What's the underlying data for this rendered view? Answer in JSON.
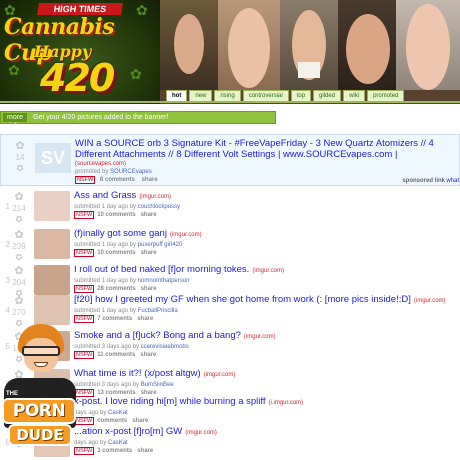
{
  "header": {
    "brand": "HIGH TIMES",
    "logo_line1": "Cannabis Cup",
    "logo_line2": "Happy",
    "logo_line3": "420",
    "tabs": [
      {
        "label": "hot",
        "active": true
      },
      {
        "label": "new",
        "active": false
      },
      {
        "label": "rising",
        "active": false
      },
      {
        "label": "controversial",
        "active": false
      },
      {
        "label": "top",
        "active": false
      },
      {
        "label": "gilded",
        "active": false
      },
      {
        "label": "wiki",
        "active": false
      },
      {
        "label": "promoted",
        "active": false
      }
    ]
  },
  "banner": {
    "text": "Get your 4/20 pictures added to the banner!",
    "link": "more info"
  },
  "sponsored": {
    "score": "14",
    "title": "WIN a SOURCE orb 3 Signature Kit - #FreeVapeFriday - 3 New Quartz Atomizers // 4 Different Attachments // 8 Different Volt Settings | www.SOURCEvapes.com |",
    "domain": "(sourcevapes.com)",
    "tagline_pre": "promoted by",
    "author": "SOURCEvapes",
    "nsfw": "NSFW",
    "comments": "8 comments",
    "share": "share",
    "thumb_text": "SV",
    "sponsored_label": "sponsored link",
    "what_label": "what"
  },
  "posts": [
    {
      "rank": "1",
      "score": "214",
      "title": "Ass and Grass",
      "domain": "(imgur.com)",
      "tagline": "submitted 1 day ago by",
      "author": "couchlockpussy",
      "nsfw": "NSFW",
      "comments": "10 comments",
      "share": "share"
    },
    {
      "rank": "2",
      "score": "239",
      "title": "(f)inally got some ganj",
      "domain": "(imgur.com)",
      "tagline": "submitted 1 day ago by",
      "author": "puxerpuff girl420",
      "nsfw": "NSFW",
      "comments": "10 comments",
      "share": "share"
    },
    {
      "rank": "3",
      "score": "204",
      "title": "I roll out of bed naked [f]or morning tokes.",
      "domain": "(imgur.com)",
      "tagline": "submitted 1 day ago by",
      "author": "nomnomthatperson",
      "nsfw": "NSFW",
      "comments": "28 comments",
      "share": "share"
    },
    {
      "rank": "4",
      "score": "270",
      "title": "[f20] how I greeted my GF when she got home from work (: [more pics inside!:D]",
      "domain": "(imgur.com)",
      "tagline": "submitted 1 day ago by",
      "author": "FucballPriscilla",
      "nsfw": "NSFW",
      "comments": "7 comments",
      "share": "share"
    },
    {
      "rank": "5",
      "score": "191",
      "title": "Smoke and a [f]uck? Bong and a bang?",
      "domain": "(imgur.com)",
      "tagline": "submitted 3 days ago by",
      "author": "ccerevisiaebmobs",
      "nsfw": "NSFW",
      "comments": "11 comments",
      "share": "share"
    },
    {
      "rank": "6",
      "score": "",
      "title": "What time is it?! (x/post altgw)",
      "domain": "(imgur.com)",
      "tagline": "submitted 3 days ago by",
      "author": "BumSlinBee",
      "nsfw": "NSFW",
      "comments": "13 comments",
      "share": "share"
    },
    {
      "rank": "7",
      "score": "",
      "title": "x-post. I love riding hi[m] while burning a spliff",
      "domain": "(i.imgur.com)",
      "tagline": "days ago by",
      "author": "CasKat",
      "nsfw": "NSFW",
      "comments": "comments",
      "share": "share"
    },
    {
      "rank": "8",
      "score": "",
      "title": "...ation x-post [f]ro[m] GW",
      "domain": "(imgur.com)",
      "tagline": "days ago by",
      "author": "CasKat",
      "nsfw": "NSFW",
      "comments": "3 comments",
      "share": "share"
    }
  ],
  "mascot": {
    "the": "THE",
    "porn": "PORN",
    "dude": "DUDE"
  },
  "colors": {
    "link": "#2020d8",
    "banner_green": "#8ec13d",
    "logo_yellow": "#f5d312",
    "mascot_orange": "#f49b22"
  }
}
